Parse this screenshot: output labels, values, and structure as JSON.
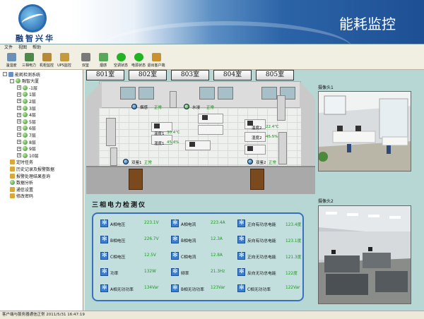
{
  "header": {
    "logo_text": "融智兴华",
    "title": "能耗监控"
  },
  "menu": [
    "文件",
    "视图",
    "帮助"
  ],
  "toolbar": [
    {
      "label": "温湿度",
      "color": "#6b8fb5",
      "icon": "thermometer-icon"
    },
    {
      "label": "三相电力",
      "color": "#4c8a4c",
      "icon": "power-icon"
    },
    {
      "label": "机柜监控",
      "color": "#b58a3a",
      "icon": "cabinet-icon"
    },
    {
      "label": "UPS监控",
      "color": "#c49a3b",
      "icon": "ups-icon"
    },
    {
      "label": "双鉴",
      "color": "#7a7a7a",
      "icon": "sensor-icon"
    },
    {
      "label": "烟感",
      "color": "#5aa65a",
      "icon": "smoke-icon"
    },
    {
      "label": "空调状态",
      "color": "#22b322",
      "icon": "aircon-icon"
    },
    {
      "label": "电源状态",
      "color": "#22b322",
      "icon": "power-status-icon"
    },
    {
      "label": "退出客户端",
      "color": "#c9922e",
      "icon": "exit-icon"
    }
  ],
  "tree": [
    {
      "label": "能耗检测系统",
      "level": 0,
      "toggle": "-",
      "icon": "sq"
    },
    {
      "label": "融智大厦",
      "level": 1,
      "toggle": "-",
      "icon": "ball"
    },
    {
      "label": "-1层",
      "level": 2,
      "toggle": "+",
      "icon": "ball"
    },
    {
      "label": "1层",
      "level": 2,
      "toggle": "+",
      "icon": "ball"
    },
    {
      "label": "2层",
      "level": 2,
      "toggle": "+",
      "icon": "ball"
    },
    {
      "label": "3层",
      "level": 2,
      "toggle": "+",
      "icon": "ball"
    },
    {
      "label": "4层",
      "level": 2,
      "toggle": "+",
      "icon": "ball"
    },
    {
      "label": "5层",
      "level": 2,
      "toggle": "+",
      "icon": "ball"
    },
    {
      "label": "6层",
      "level": 2,
      "toggle": "+",
      "icon": "ball"
    },
    {
      "label": "7层",
      "level": 2,
      "toggle": "+",
      "icon": "ball"
    },
    {
      "label": "8层",
      "level": 2,
      "toggle": "+",
      "icon": "ball"
    },
    {
      "label": "9层",
      "level": 2,
      "toggle": "+",
      "icon": "ball"
    },
    {
      "label": "10层",
      "level": 2,
      "toggle": "+",
      "icon": "ball"
    },
    {
      "label": "定时任务",
      "level": 1,
      "toggle": "",
      "icon": "gold"
    },
    {
      "label": "历史记录及报警数据",
      "level": 1,
      "toggle": "",
      "icon": "gold"
    },
    {
      "label": "报警处理结果查询",
      "level": 1,
      "toggle": "",
      "icon": "gold"
    },
    {
      "label": "数据分析",
      "level": 1,
      "toggle": "",
      "icon": "ball"
    },
    {
      "label": "通信设置",
      "level": 1,
      "toggle": "",
      "icon": "gold"
    },
    {
      "label": "修改密码",
      "level": 1,
      "toggle": "",
      "icon": "gold"
    }
  ],
  "rooms": [
    "801室",
    "802室",
    "803室",
    "804室",
    "805室"
  ],
  "floorplan": {
    "smoke_label": "烟感",
    "smoke_value": "正常",
    "water_label": "水浸",
    "water_value": "正常",
    "temp1_label": "温度1",
    "temp1_value": "30.4℃",
    "hum1_label": "湿度1",
    "hum1_value": "45.4%",
    "temp2_label": "温度2",
    "temp2_value": "22.4℃",
    "hum2_label": "湿度2",
    "hum2_value": "45.5%",
    "dual1_label": "双鉴1",
    "dual1_value": "正常",
    "dual2_label": "双鉴2",
    "dual2_value": "正常"
  },
  "meter": {
    "title": "三相电力检测仪",
    "rows": [
      [
        {
          "label": "A相电压",
          "value": "223.1V"
        },
        {
          "label": "A相电流",
          "value": "223.4A"
        },
        {
          "label": "正向有功总电能",
          "value": "123.4度"
        }
      ],
      [
        {
          "label": "B相电压",
          "value": "226.7V"
        },
        {
          "label": "B相电流",
          "value": "12.3A"
        },
        {
          "label": "反向有功总电能",
          "value": "123.1度"
        }
      ],
      [
        {
          "label": "C相电压",
          "value": "12.5V"
        },
        {
          "label": "C相电流",
          "value": "12.8A"
        },
        {
          "label": "正向无功总电能",
          "value": "121.3度"
        }
      ],
      [
        {
          "label": "功率",
          "value": "132W"
        },
        {
          "label": "频率",
          "value": "21.3Hz"
        },
        {
          "label": "反向无功总电能",
          "value": "122度"
        }
      ],
      [
        {
          "label": "A相无功功率",
          "value": "134Var"
        },
        {
          "label": "B相无功功率",
          "value": "123Var"
        },
        {
          "label": "C相无功功率",
          "value": "122Var"
        }
      ]
    ]
  },
  "cameras": [
    {
      "label": "摄像头1"
    },
    {
      "label": "摄像头2"
    }
  ],
  "statusbar": "客户端与服务器通信正常    2011/5/31 16:47:19"
}
